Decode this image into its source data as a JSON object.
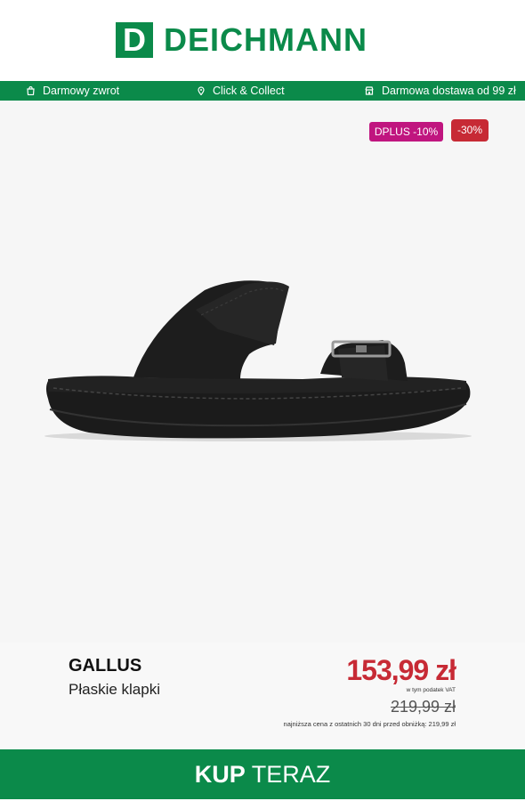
{
  "brand_logo": {
    "mark": "D",
    "name": "DEICHMANN"
  },
  "benefits": [
    {
      "icon": "bag-icon",
      "label": "Darmowy zwrot"
    },
    {
      "icon": "location-pin-icon",
      "label": "Click & Collect"
    },
    {
      "icon": "store-icon",
      "label": "Darmowa dostawa od 99 zł"
    }
  ],
  "badges": {
    "dplus": "DPLUS -10%",
    "sale": "-30%"
  },
  "product": {
    "brand": "GALLUS",
    "name": "Płaskie klapki",
    "price": "153,99 zł",
    "vat_note": "w tym podatek VAT",
    "old_price": "219,99 zł",
    "lowest_price_note": "najniższa cena z ostatnich 30 dni przed obniżką: 219,99 zł"
  },
  "cta": {
    "strong": "KUP",
    "rest": " TERAZ"
  },
  "colors": {
    "brand_green": "#0b8a4a",
    "sale_red": "#c72a35",
    "dplus_magenta": "#c0157f"
  }
}
